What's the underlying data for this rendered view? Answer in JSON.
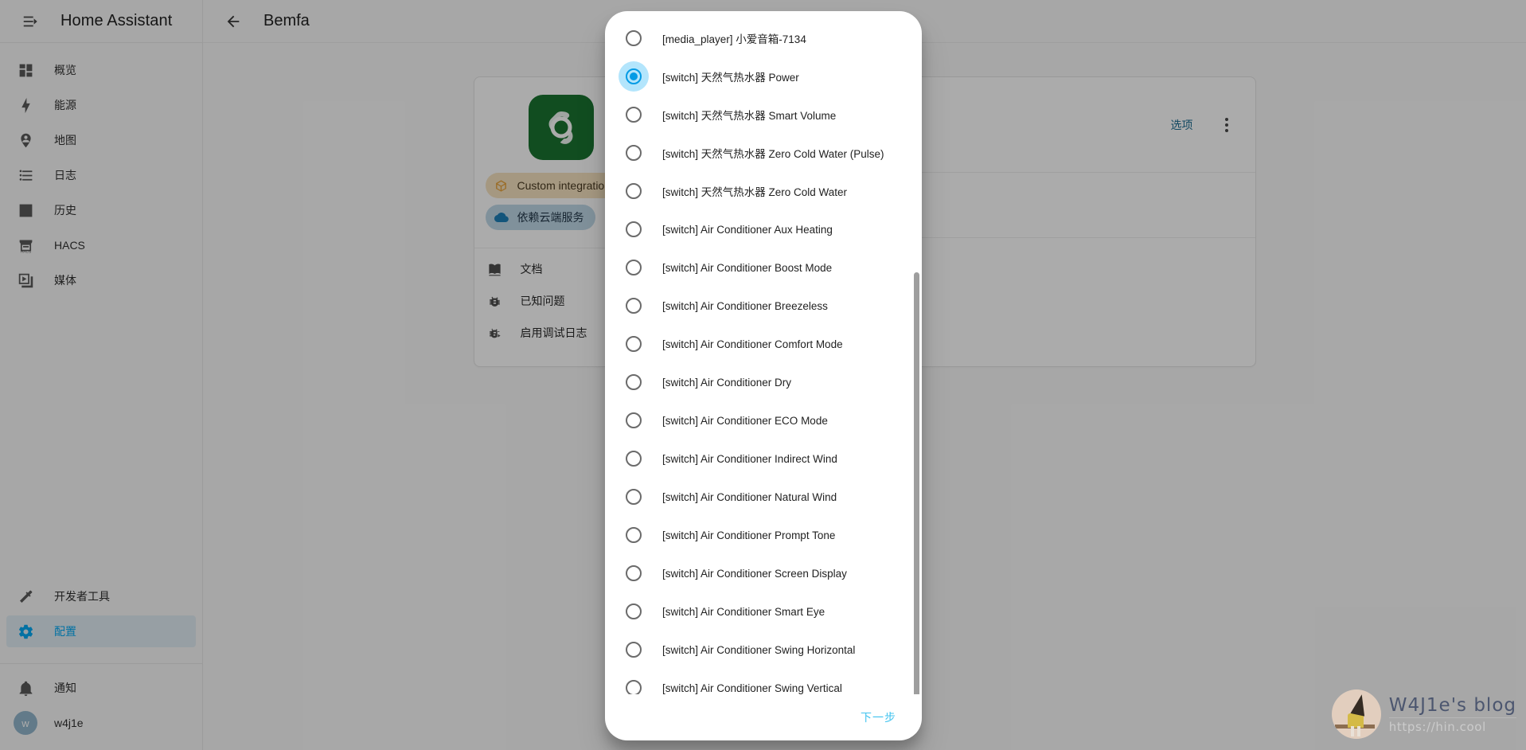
{
  "sidebar": {
    "title": "Home Assistant",
    "menu_icon": "menu-collapse-icon",
    "items": [
      {
        "label": "概览",
        "icon": "view-dashboard-icon",
        "active": false
      },
      {
        "label": "能源",
        "icon": "lightning-bolt-icon",
        "active": false
      },
      {
        "label": "地图",
        "icon": "map-marker-account-icon",
        "active": false
      },
      {
        "label": "日志",
        "icon": "format-list-bulleted-icon",
        "active": false
      },
      {
        "label": "历史",
        "icon": "chart-box-icon",
        "active": false
      },
      {
        "label": "HACS",
        "icon": "hacs-storefront-icon",
        "active": false
      },
      {
        "label": "媒体",
        "icon": "play-box-multiple-icon",
        "active": false
      }
    ],
    "bottom_items": [
      {
        "label": "开发者工具",
        "icon": "hammer-icon",
        "active": false
      },
      {
        "label": "配置",
        "icon": "cog-icon",
        "active": true
      }
    ],
    "footer_items": [
      {
        "label": "通知",
        "icon": "bell-icon"
      }
    ],
    "user": {
      "label": "w4j1e",
      "initial": "w"
    }
  },
  "toolbar": {
    "back_icon": "arrow-left-icon",
    "title": "Bemfa"
  },
  "card": {
    "logo_icon": "bemfa-logo-icon",
    "chips": [
      {
        "label": "Custom integration",
        "icon": "package-icon",
        "style": "custom"
      },
      {
        "label": "依赖云端服务",
        "icon": "cloud-icon",
        "style": "cloud"
      }
    ],
    "links": [
      {
        "label": "文档",
        "icon": "book-open-icon"
      },
      {
        "label": "已知问题",
        "icon": "bug-icon"
      },
      {
        "label": "启用调试日志",
        "icon": "bug-play-icon"
      }
    ],
    "options_label": "选项",
    "overflow_icon": "dots-vertical-icon"
  },
  "dialog": {
    "next_label": "下一步",
    "selected_index": 1,
    "accent_color": "#039be5",
    "next_color": "#41c3ef",
    "options": [
      "[media_player] 小爱音箱-7134",
      "[switch] 天然气热水器 Power",
      "[switch] 天然气热水器 Smart Volume",
      "[switch] 天然气热水器 Zero Cold Water (Pulse)",
      "[switch] 天然气热水器 Zero Cold Water",
      "[switch] Air Conditioner Aux Heating",
      "[switch] Air Conditioner Boost Mode",
      "[switch] Air Conditioner Breezeless",
      "[switch] Air Conditioner Comfort Mode",
      "[switch] Air Conditioner Dry",
      "[switch] Air Conditioner ECO Mode",
      "[switch] Air Conditioner Indirect Wind",
      "[switch] Air Conditioner Natural Wind",
      "[switch] Air Conditioner Prompt Tone",
      "[switch] Air Conditioner Screen Display",
      "[switch] Air Conditioner Smart Eye",
      "[switch] Air Conditioner Swing Horizontal",
      "[switch] Air Conditioner Swing Vertical"
    ]
  },
  "watermark": {
    "title": "W4J1e's blog",
    "url": "https://hin.cool"
  }
}
